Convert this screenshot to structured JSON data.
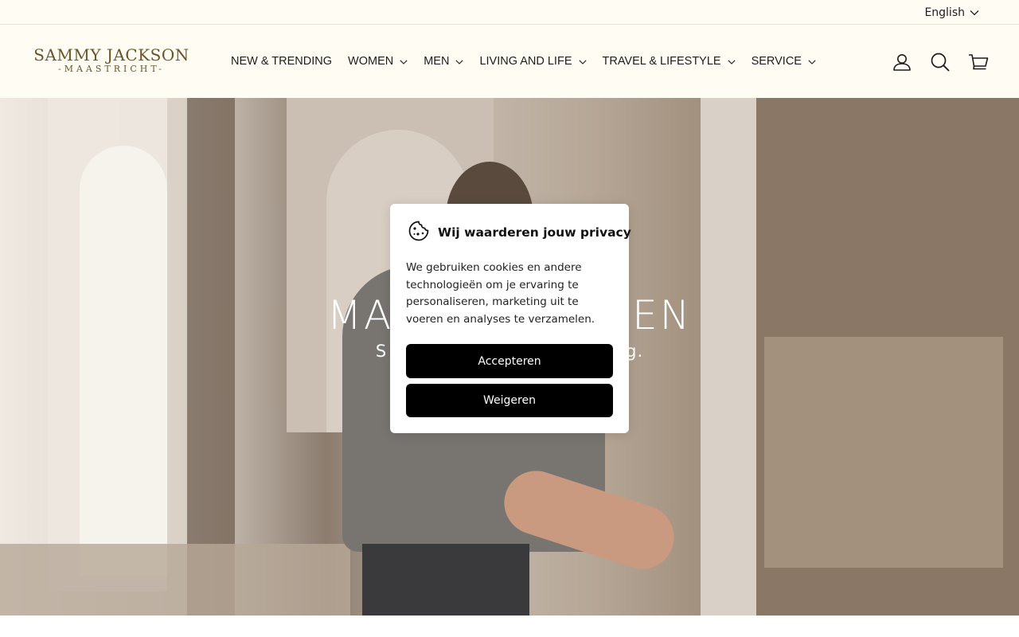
{
  "topbar": {
    "language": "English"
  },
  "header": {
    "logo": {
      "main": "SAMMY JACKSON",
      "sub": "-MAASTRICHT-"
    },
    "nav": [
      {
        "label": "NEW & TRENDING",
        "has_dropdown": false
      },
      {
        "label": "WOMEN",
        "has_dropdown": true
      },
      {
        "label": "MEN",
        "has_dropdown": true
      },
      {
        "label": "LIVING AND LIFE",
        "has_dropdown": true
      },
      {
        "label": "TRAVEL & LIFESTYLE",
        "has_dropdown": true
      },
      {
        "label": "SERVICE",
        "has_dropdown": true
      }
    ],
    "icons": [
      "account-icon",
      "search-icon",
      "cart-icon"
    ]
  },
  "hero": {
    "title_left": "MA",
    "title_right": "EN",
    "sub_left": "S",
    "sub_right": "g."
  },
  "cookie_modal": {
    "icon": "cookie-icon",
    "title": "Wij waarderen jouw privacy",
    "text": "We gebruiken cookies en andere technologieën om je ervaring te personaliseren, marketing uit te voeren en analyses te verzamelen.",
    "accept_label": "Accepteren",
    "reject_label": "Weigeren"
  },
  "colors": {
    "header_bg": "#fffcf4",
    "logo": "#6b5428",
    "button_bg": "#000000",
    "button_text": "#ffffff"
  }
}
